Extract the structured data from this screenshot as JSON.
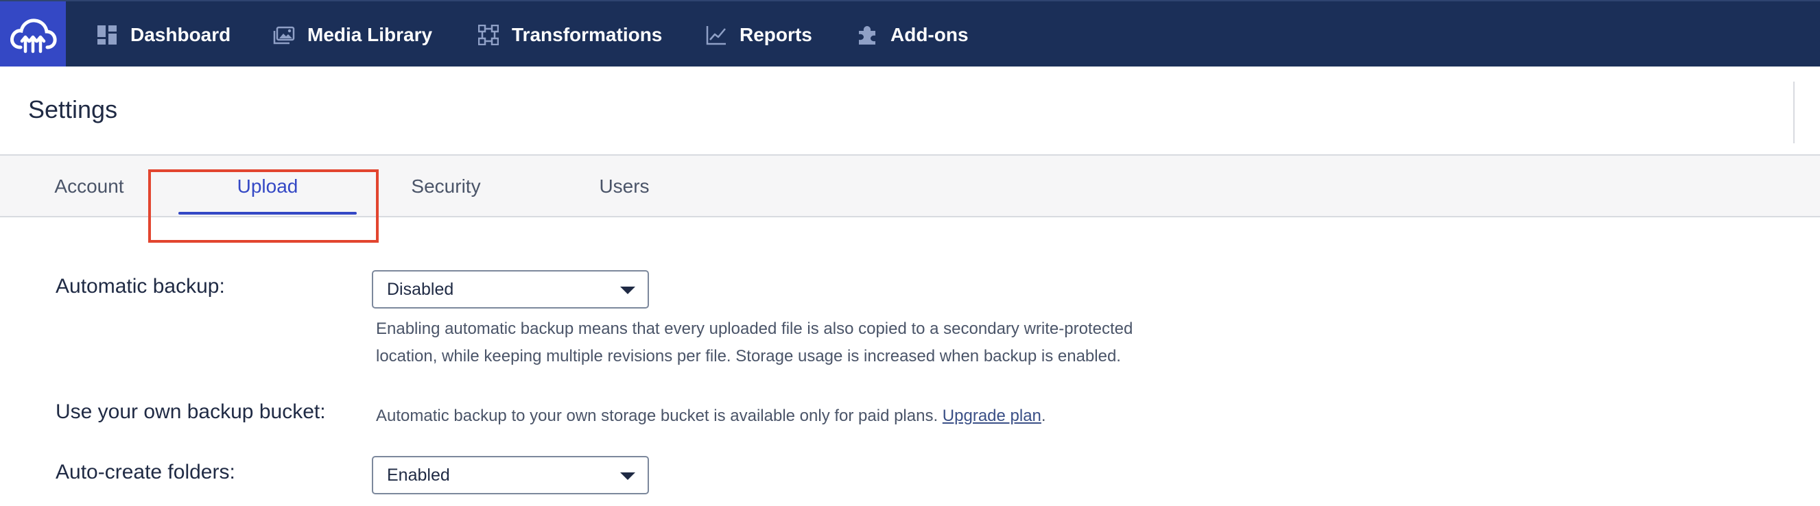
{
  "nav": {
    "logo_icon": "cloudinary-cloud-logo-icon",
    "items": [
      {
        "label": "Dashboard",
        "icon": "dashboard-grid-icon"
      },
      {
        "label": "Media Library",
        "icon": "media-images-icon"
      },
      {
        "label": "Transformations",
        "icon": "transformations-icon"
      },
      {
        "label": "Reports",
        "icon": "line-chart-icon"
      },
      {
        "label": "Add-ons",
        "icon": "puzzle-piece-icon"
      }
    ]
  },
  "page": {
    "title": "Settings"
  },
  "tabs": [
    {
      "label": "Account",
      "active": false
    },
    {
      "label": "Upload",
      "active": true
    },
    {
      "label": "Security",
      "active": false
    },
    {
      "label": "Users",
      "active": false
    }
  ],
  "form": {
    "automatic_backup": {
      "label": "Automatic backup:",
      "value": "Disabled",
      "help_line1": "Enabling automatic backup means that every uploaded file is also copied to a secondary write-protected",
      "help_line2": "location, while keeping multiple revisions per file. Storage usage is increased when backup is enabled."
    },
    "own_bucket": {
      "label": "Use your own backup bucket:",
      "text": "Automatic backup to your own storage bucket is available only for paid plans. ",
      "link": "Upgrade plan",
      "suffix": "."
    },
    "auto_create_folders": {
      "label": "Auto-create folders:",
      "value": "Enabled"
    }
  },
  "colors": {
    "nav_bg": "#1b2f58",
    "logo_bg": "#3448c5",
    "accent": "#3448c5",
    "highlight": "#e2452f"
  }
}
